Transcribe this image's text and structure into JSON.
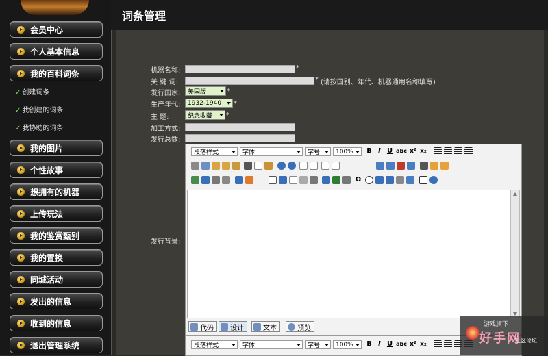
{
  "sidebar": {
    "items": [
      {
        "label": "会员中心"
      },
      {
        "label": "个人基本信息"
      },
      {
        "label": "我的百科词条"
      },
      {
        "label": "我的图片"
      },
      {
        "label": "个性故事"
      },
      {
        "label": "想拥有的机器"
      },
      {
        "label": "上传玩法"
      },
      {
        "label": "我的鉴赏甄别"
      },
      {
        "label": "我的置换"
      },
      {
        "label": "同城活动"
      },
      {
        "label": "发出的信息"
      },
      {
        "label": "收到的信息"
      },
      {
        "label": "退出管理系统"
      }
    ],
    "sub_items": [
      {
        "label": "创建词条"
      },
      {
        "label": "我创建的词条"
      },
      {
        "label": "我协助的词条"
      }
    ]
  },
  "header": {
    "title": "词条管理"
  },
  "form": {
    "machine_name_label": "机器名称:",
    "keywords_label": "关 键 词:",
    "keywords_hint": "(请按国别、年代、机器通用名称填写)",
    "country_label": "发行国家:",
    "country_value": "美国版",
    "year_label": "生产年代:",
    "year_value": "1932-1940",
    "theme_label": "主    题:",
    "theme_value": "纪念收藏",
    "process_label": "加工方式:",
    "total_label": "发行总数:",
    "background_label": "发行背景:",
    "required_mark": "*"
  },
  "editor": {
    "paragraph_style": "段落样式",
    "font": "字体",
    "font_size": "字号",
    "zoom": "100%",
    "bold": "B",
    "italic": "I",
    "underline": "U",
    "strike": "abc",
    "superscript": "x²",
    "subscript": "x₂",
    "omega": "Ω",
    "modes": {
      "code": "代码",
      "design": "设计",
      "text": "文本",
      "preview": "预览"
    }
  },
  "watermark": {
    "line1": "游戏旗下",
    "line2": "好手网",
    "line3": "社区论坛"
  }
}
